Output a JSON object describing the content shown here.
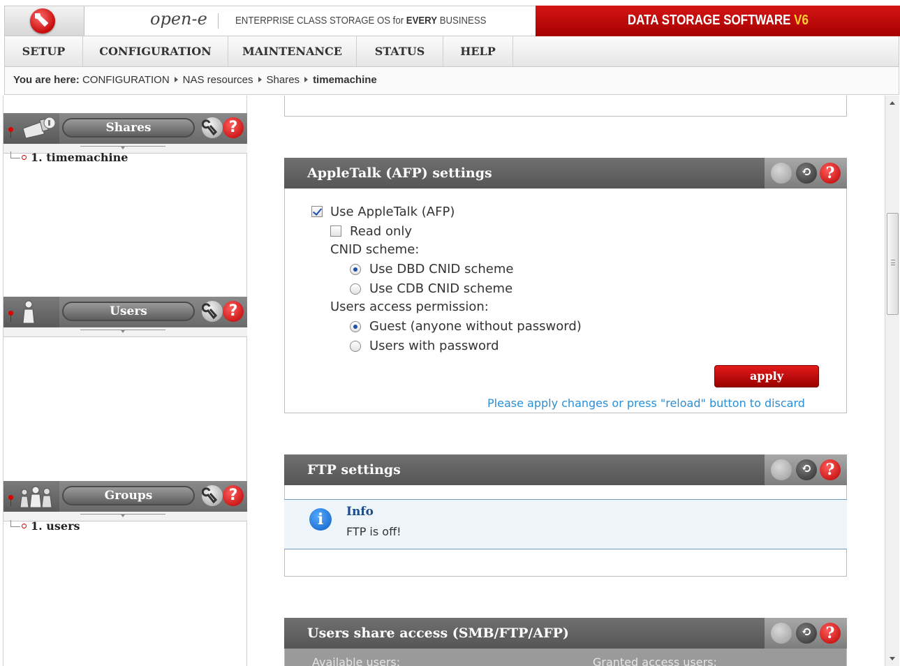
{
  "header": {
    "brand": "open-e",
    "tagline_prefix": "ENTERPRISE CLASS STORAGE OS for ",
    "tagline_bold": "EVERY",
    "tagline_suffix": " BUSINESS",
    "product": "DATA STORAGE SOFTWARE ",
    "product_version": "V6",
    "accent_color": "#c00000"
  },
  "menu": {
    "items": [
      "SETUP",
      "CONFIGURATION",
      "MAINTENANCE",
      "STATUS",
      "HELP"
    ]
  },
  "breadcrumb": {
    "prefix": "You are here:",
    "items": [
      "CONFIGURATION",
      "NAS resources",
      "Shares"
    ],
    "current": "timemachine"
  },
  "left": {
    "shares": {
      "title": "Shares",
      "icon": "shares-icon",
      "items": [
        "1. timemachine"
      ]
    },
    "users": {
      "title": "Users",
      "icon": "user-icon",
      "items": []
    },
    "groups": {
      "title": "Groups",
      "icon": "group-icon",
      "items": [
        "1. users"
      ]
    },
    "help_glyph": "?"
  },
  "afp": {
    "title": "AppleTalk (AFP) settings",
    "use_label": "Use AppleTalk (AFP)",
    "use_checked": true,
    "readonly_label": "Read only",
    "readonly_checked": false,
    "cnid_label": "CNID scheme:",
    "cnid_options": [
      "Use DBD CNID scheme",
      "Use CDB CNID scheme"
    ],
    "cnid_selected": "Use DBD CNID scheme",
    "perm_label": "Users access permission:",
    "perm_options": [
      "Guest (anyone without password)",
      "Users with password"
    ],
    "perm_selected": "Guest (anyone without password)",
    "apply": "apply",
    "note": "Please apply changes or press \"reload\" button to discard"
  },
  "ftp": {
    "title": "FTP settings",
    "info_title": "Info",
    "info_text": "FTP is off!",
    "info_glyph": "i"
  },
  "access": {
    "title": "Users share access (SMB/FTP/AFP)",
    "available": "Available users:",
    "granted": "Granted access users:"
  }
}
